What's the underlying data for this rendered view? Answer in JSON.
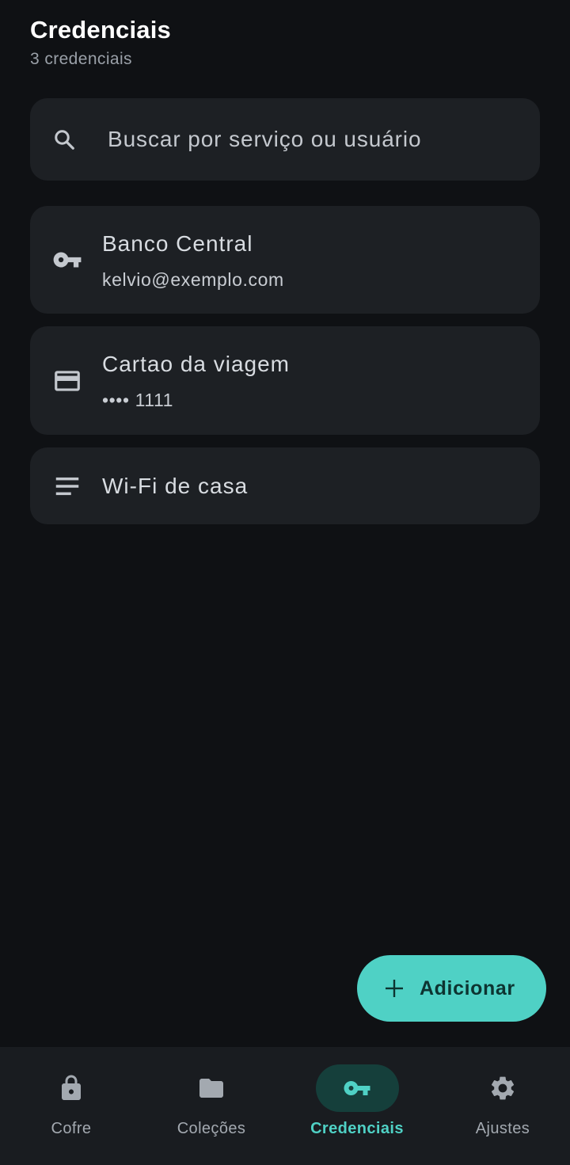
{
  "header": {
    "title": "Credenciais",
    "subtitle": "3 credenciais"
  },
  "search": {
    "placeholder": "Buscar por serviço ou usuário",
    "icon": "search-icon"
  },
  "credentials": [
    {
      "name": "Banco Central",
      "detail": "kelvio@exemplo.com",
      "icon": "key-icon"
    },
    {
      "name": "Cartao da viagem",
      "detail": "•••• 1111",
      "icon": "credit-card-icon"
    },
    {
      "name": "Wi-Fi de casa",
      "detail": "",
      "icon": "notes-icon"
    }
  ],
  "fab": {
    "label": "Adicionar",
    "icon": "plus-icon"
  },
  "nav": [
    {
      "label": "Cofre",
      "icon": "lock-icon",
      "active": false
    },
    {
      "label": "Coleções",
      "icon": "folder-icon",
      "active": false
    },
    {
      "label": "Credenciais",
      "icon": "key-icon",
      "active": true
    },
    {
      "label": "Ajustes",
      "icon": "gear-icon",
      "active": false
    }
  ],
  "colors": {
    "background": "#0f1114",
    "surface": "#1d2024",
    "accent": "#4fd1c5",
    "active_pill": "#153f3b",
    "navbar": "#191c20"
  }
}
